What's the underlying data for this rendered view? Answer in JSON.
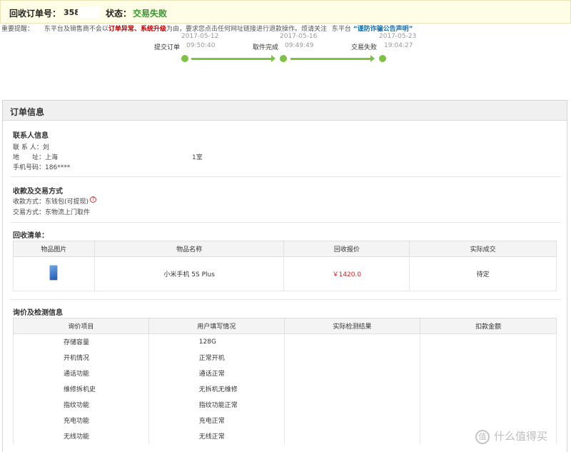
{
  "header": {
    "order_label": "回收订单号：",
    "order_number": "358",
    "status_label": "状态：",
    "status_value": "交易失败"
  },
  "warning": {
    "prefix": "重要提醒：",
    "text1": "东平台及销售商不会以",
    "highlight1": "订单异常",
    "sep": "、",
    "highlight2": "系统升级",
    "text2": "为由，要求您点击任何网址链接进行退款操作。烦请关注",
    "text3": "东平台",
    "notice": "“谨防诈骗公告声明”"
  },
  "progress": {
    "steps": [
      {
        "date": "2017-05-12",
        "name": "提交订单",
        "time": "09:50:40"
      },
      {
        "date": "2017-05-16",
        "name": "取件完成",
        "time": "09:49:49"
      },
      {
        "date": "2017-05-23",
        "name": "交易失败",
        "time": "19:04:27"
      }
    ]
  },
  "panel": {
    "title": "订单信息",
    "contact": {
      "title": "联系人信息",
      "name_label": "联 系 人：",
      "name_value": "刘",
      "address_label": "地　　址：",
      "address_value": "上海",
      "address_room": "1室",
      "phone_label": "手机号码：",
      "phone_value": "186****"
    },
    "payment": {
      "title": "收款及交易方式",
      "method_label": "收款方式：",
      "method_value": "东钱包(可提现)",
      "help_icon": "?",
      "trade_label": "交易方式：",
      "trade_value": "东物流上门取件"
    },
    "recycle": {
      "title": "回收清单：",
      "columns": [
        "物品图片",
        "物品名称",
        "回收报价",
        "实际成交"
      ],
      "item": {
        "name": "小米手机 5S Plus",
        "price": "￥1420.0",
        "deal": "待定"
      }
    },
    "inspection": {
      "title": "询价及检测信息",
      "columns": [
        "询价项目",
        "用户填写情况",
        "实际检测结果",
        "扣款金额"
      ],
      "rows": [
        {
          "item": "存储容量",
          "user": "128G"
        },
        {
          "item": "开机情况",
          "user": "正常开机"
        },
        {
          "item": "通话功能",
          "user": "通话正常"
        },
        {
          "item": "维修拆机史",
          "user": "无拆机无维修"
        },
        {
          "item": "指纹功能",
          "user": "指纹功能正常"
        },
        {
          "item": "充电功能",
          "user": "充电正常"
        },
        {
          "item": "无线功能",
          "user": "无线正常"
        }
      ]
    }
  },
  "watermark": {
    "icon": "值",
    "text": "什么值得买"
  },
  "colors": {
    "accent_green": "#7dc242",
    "status_green": "#2f9a2a",
    "price_red": "#d41c1c",
    "notice_blue": "#1d6fa5"
  }
}
